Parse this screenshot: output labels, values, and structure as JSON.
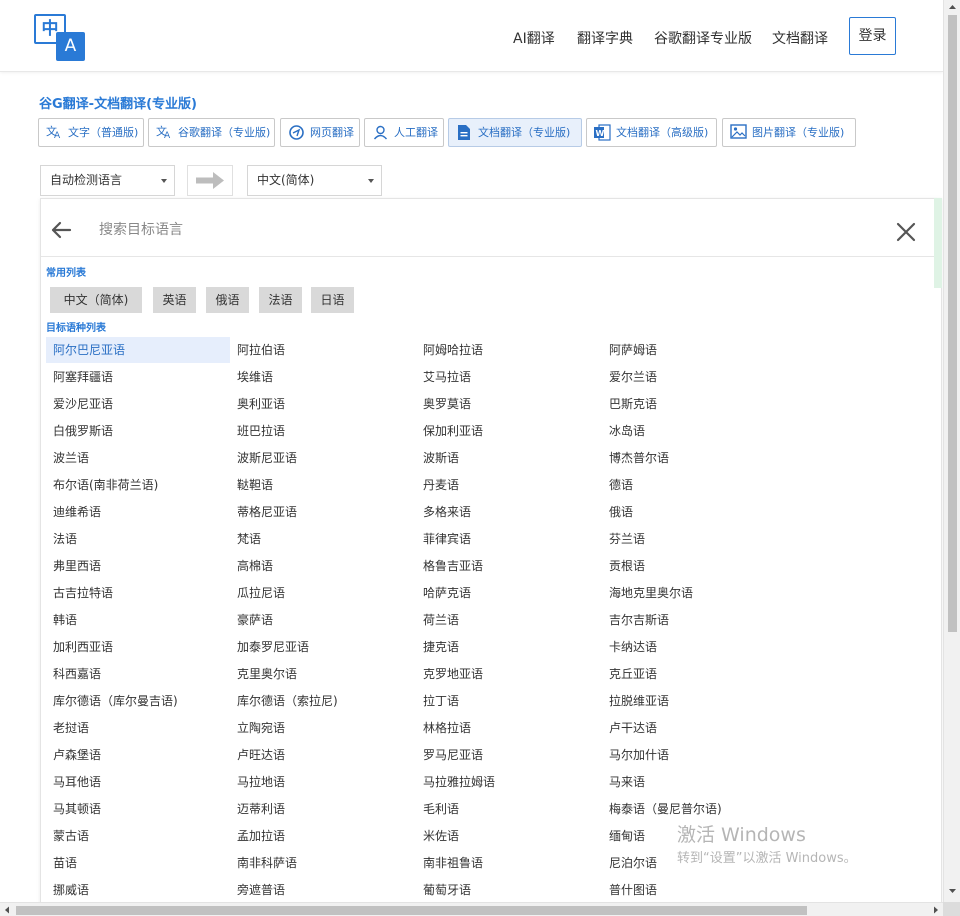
{
  "header": {
    "logo": {
      "top_glyph": "中",
      "bottom_glyph": "A"
    },
    "nav": [
      "AI翻译",
      "翻译字典",
      "谷歌翻译专业版",
      "文档翻译"
    ],
    "login": "登录"
  },
  "page_title": "谷G翻译-文档翻译(专业版)",
  "tabs": [
    {
      "label": "文字（普通版)",
      "icon": "translate-icon"
    },
    {
      "label": "谷歌翻译（专业版)",
      "icon": "translate-icon"
    },
    {
      "label": "网页翻译",
      "icon": "web-translate-icon"
    },
    {
      "label": "人工翻译",
      "icon": "human-translate-icon"
    },
    {
      "label": "文档翻译（专业版)",
      "icon": "document-icon",
      "active": true
    },
    {
      "label": "文档翻译（高级版)",
      "icon": "word-icon"
    },
    {
      "label": "图片翻译（专业版)",
      "icon": "image-icon"
    }
  ],
  "source_language": "自动检测语言",
  "target_language": "中文(简体)",
  "search": {
    "placeholder": "搜索目标语言"
  },
  "common_label": "常用列表",
  "common_languages": [
    "中文（简体)",
    "英语",
    "俄语",
    "法语",
    "日语"
  ],
  "target_list_label": "目标语种列表",
  "languages": [
    [
      "阿尔巴尼亚语",
      "阿拉伯语",
      "阿姆哈拉语",
      "阿萨姆语"
    ],
    [
      "阿塞拜疆语",
      "埃维语",
      "艾马拉语",
      "爱尔兰语"
    ],
    [
      "爱沙尼亚语",
      "奥利亚语",
      "奥罗莫语",
      "巴斯克语"
    ],
    [
      "白俄罗斯语",
      "班巴拉语",
      "保加利亚语",
      "冰岛语"
    ],
    [
      "波兰语",
      "波斯尼亚语",
      "波斯语",
      "博杰普尔语"
    ],
    [
      "布尔语(南非荷兰语)",
      "鞑靼语",
      "丹麦语",
      "德语"
    ],
    [
      "迪维希语",
      "蒂格尼亚语",
      "多格来语",
      "俄语"
    ],
    [
      "法语",
      "梵语",
      "菲律宾语",
      "芬兰语"
    ],
    [
      "弗里西语",
      "高棉语",
      "格鲁吉亚语",
      "贡根语"
    ],
    [
      "古吉拉特语",
      "瓜拉尼语",
      "哈萨克语",
      "海地克里奥尔语"
    ],
    [
      "韩语",
      "豪萨语",
      "荷兰语",
      "吉尔吉斯语"
    ],
    [
      "加利西亚语",
      "加泰罗尼亚语",
      "捷克语",
      "卡纳达语"
    ],
    [
      "科西嘉语",
      "克里奥尔语",
      "克罗地亚语",
      "克丘亚语"
    ],
    [
      "库尔德语（库尔曼吉语)",
      "库尔德语（索拉尼)",
      "拉丁语",
      "拉脱维亚语"
    ],
    [
      "老挝语",
      "立陶宛语",
      "林格拉语",
      "卢干达语"
    ],
    [
      "卢森堡语",
      "卢旺达语",
      "罗马尼亚语",
      "马尔加什语"
    ],
    [
      "马耳他语",
      "马拉地语",
      "马拉雅拉姆语",
      "马来语"
    ],
    [
      "马其顿语",
      "迈蒂利语",
      "毛利语",
      "梅泰语（曼尼普尔语)"
    ],
    [
      "蒙古语",
      "孟加拉语",
      "米佐语",
      "缅甸语"
    ],
    [
      "苗语",
      "南非科萨语",
      "南非祖鲁语",
      "尼泊尔语"
    ],
    [
      "挪威语",
      "旁遮普语",
      "葡萄牙语",
      "普什图语"
    ]
  ],
  "watermark": {
    "line1": "激活 Windows",
    "line2": "转到“设置”以激活 Windows。"
  },
  "colors": {
    "accent": "#2a7ad6",
    "highlight": "#e6eefc",
    "chip": "#d9d9d9"
  }
}
